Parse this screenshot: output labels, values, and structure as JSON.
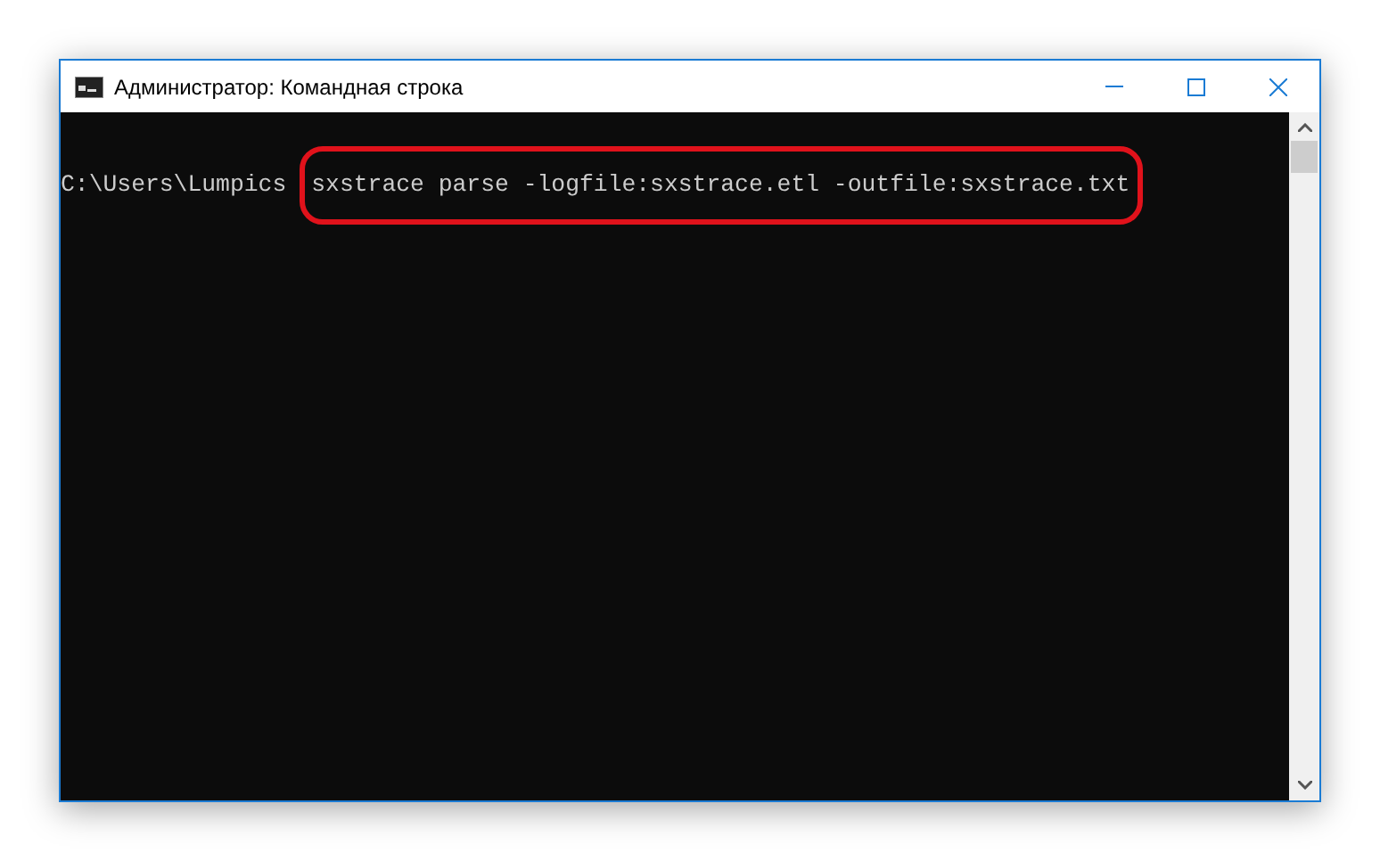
{
  "window": {
    "title": "Администратор: Командная строка"
  },
  "console": {
    "prompt": "C:\\Users\\Lumpics",
    "command": "sxstrace parse -logfile:sxstrace.etl -outfile:sxstrace.txt",
    "highlighted": true
  }
}
